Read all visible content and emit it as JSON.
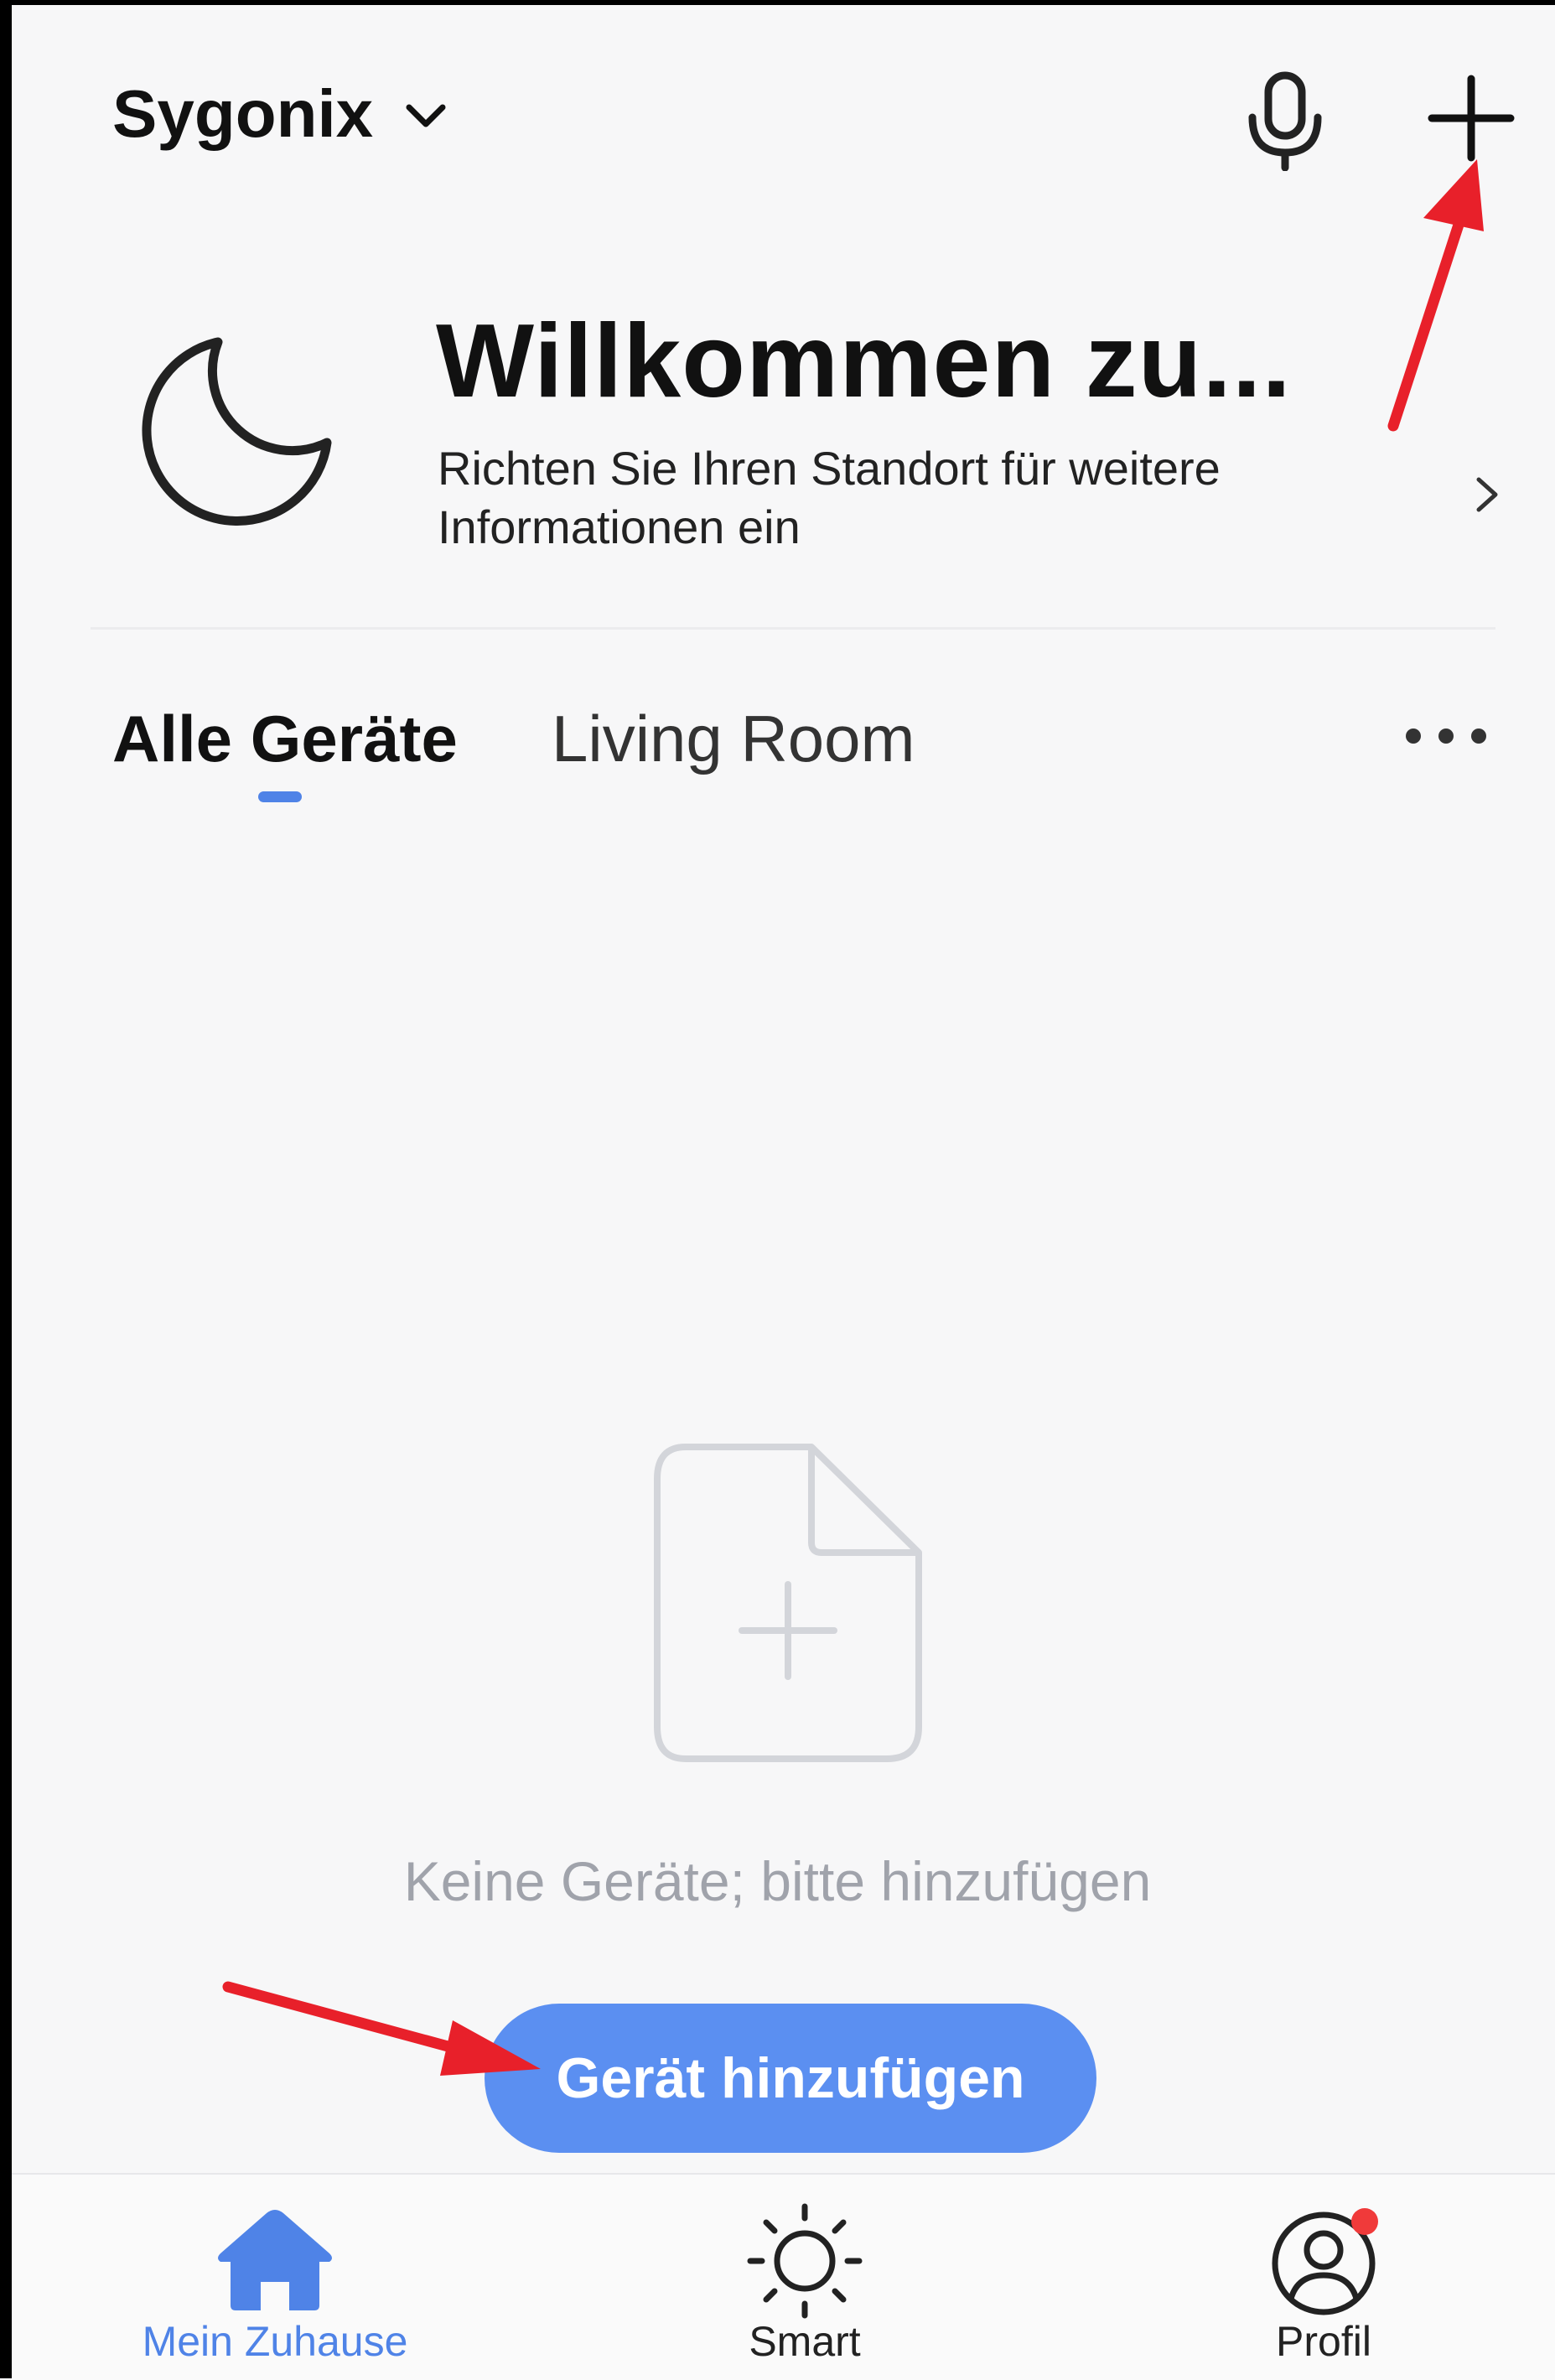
{
  "header": {
    "home_name": "Sygonix"
  },
  "welcome": {
    "title": "Willkommen zu...",
    "subtitle": "Richten Sie Ihren Standort für weitere Informationen ein"
  },
  "tabs": [
    {
      "label": "Alle Geräte",
      "active": true
    },
    {
      "label": "Living Room",
      "active": false
    }
  ],
  "empty_state": {
    "message": "Keine Geräte; bitte hinzufügen",
    "button_label": "Gerät hinzufügen"
  },
  "bottom_nav": [
    {
      "label": "Mein Zuhause",
      "icon": "home-icon",
      "active": true
    },
    {
      "label": "Smart",
      "icon": "sun-icon",
      "active": false
    },
    {
      "label": "Profil",
      "icon": "user-icon",
      "active": false,
      "badge": true
    }
  ],
  "colors": {
    "accent": "#5b8ff1",
    "active_tab": "#4f83e7",
    "annotation_arrow": "#e8202a",
    "badge": "#f03a3a"
  }
}
